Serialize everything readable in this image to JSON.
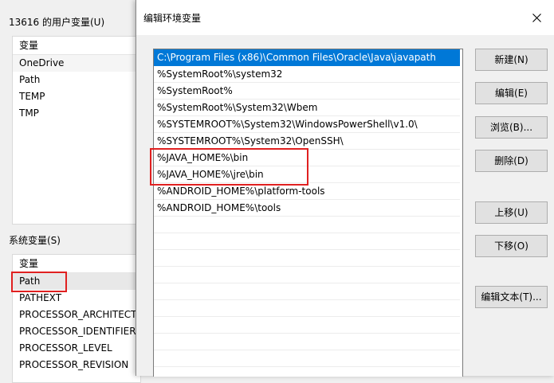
{
  "background": {
    "user_vars_label": "13616 的用户变量(U)",
    "user_vars_header": "变量",
    "user_vars": [
      "OneDrive",
      "Path",
      "TEMP",
      "TMP"
    ],
    "sys_vars_label": "系统变量(S)",
    "sys_vars_header": "变量",
    "sys_vars": [
      "Path",
      "PATHEXT",
      "PROCESSOR_ARCHITECT...",
      "PROCESSOR_IDENTIFIER",
      "PROCESSOR_LEVEL",
      "PROCESSOR_REVISION"
    ]
  },
  "dialog": {
    "title": "编辑环境变量",
    "paths": [
      "C:\\Program Files (x86)\\Common Files\\Oracle\\Java\\javapath",
      "%SystemRoot%\\system32",
      "%SystemRoot%",
      "%SystemRoot%\\System32\\Wbem",
      "%SYSTEMROOT%\\System32\\WindowsPowerShell\\v1.0\\",
      "%SYSTEMROOT%\\System32\\OpenSSH\\",
      "%JAVA_HOME%\\bin",
      "%JAVA_HOME%\\jre\\bin",
      "%ANDROID_HOME%\\platform-tools",
      "%ANDROID_HOME%\\tools"
    ],
    "buttons": {
      "new": "新建(N)",
      "edit": "编辑(E)",
      "browse": "浏览(B)...",
      "delete": "删除(D)",
      "move_up": "上移(U)",
      "move_down": "下移(O)",
      "edit_text": "编辑文本(T)..."
    }
  },
  "colors": {
    "selection": "#0078d7",
    "highlight": "#e02020"
  }
}
